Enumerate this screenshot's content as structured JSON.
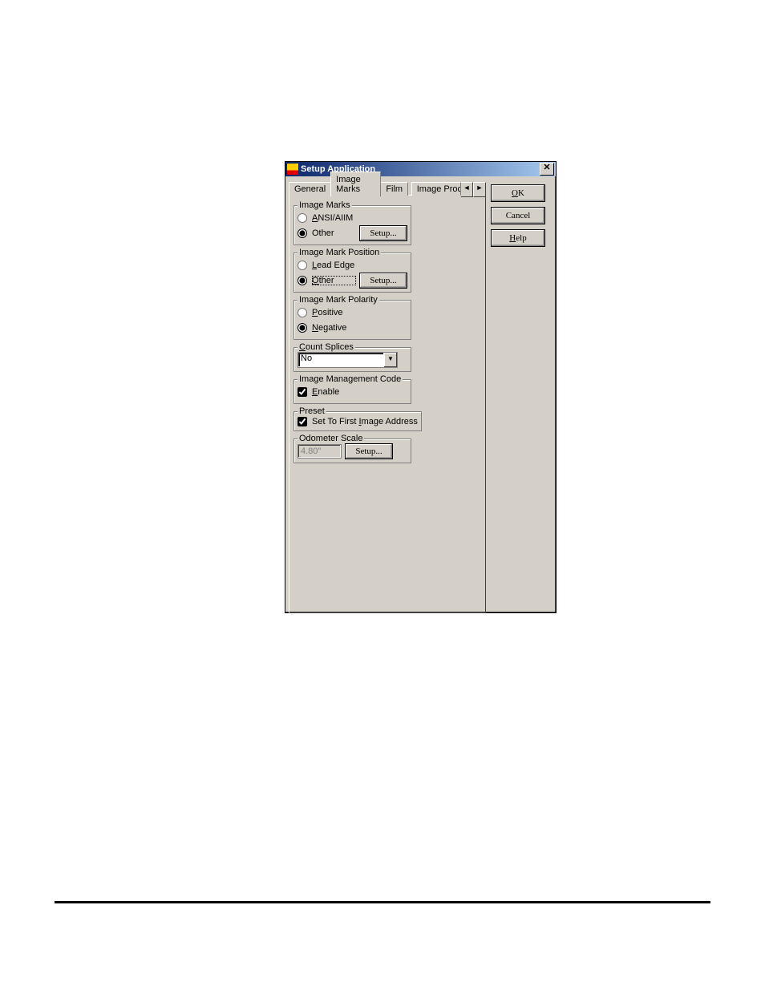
{
  "window": {
    "title": "Setup Application",
    "close_glyph": "✕"
  },
  "tabs": {
    "general": "General",
    "image_marks": "Image Marks",
    "film": "Film",
    "image_proc": "Image Proce",
    "scroll_left": "◄",
    "scroll_right": "►"
  },
  "groups": {
    "image_marks": {
      "legend": "Image Marks",
      "ansi": "ANSI/AIIM",
      "other": "Other",
      "setup": "Setup..."
    },
    "position": {
      "legend": "Image Mark Position",
      "lead_edge": "Lead Edge",
      "other": "Other",
      "setup": "Setup..."
    },
    "polarity": {
      "legend": "Image Mark Polarity",
      "positive": "Positive",
      "negative": "Negative"
    },
    "count_splices": {
      "legend": "Count Splices",
      "value": "No"
    },
    "imc": {
      "legend": "Image Management Code",
      "enable": "Enable"
    },
    "preset": {
      "legend": "Preset",
      "set_first": "Set To First Image Address"
    },
    "odometer": {
      "legend": "Odometer Scale",
      "value": "4.80\"",
      "setup": "Setup..."
    }
  },
  "buttons": {
    "ok": "OK",
    "cancel": "Cancel",
    "help": "Help"
  },
  "mnemonics": {
    "A": "A",
    "L": "L",
    "P": "P",
    "N": "N",
    "C": "C",
    "E": "E",
    "I": "I",
    "O": "O",
    "H": "H"
  }
}
